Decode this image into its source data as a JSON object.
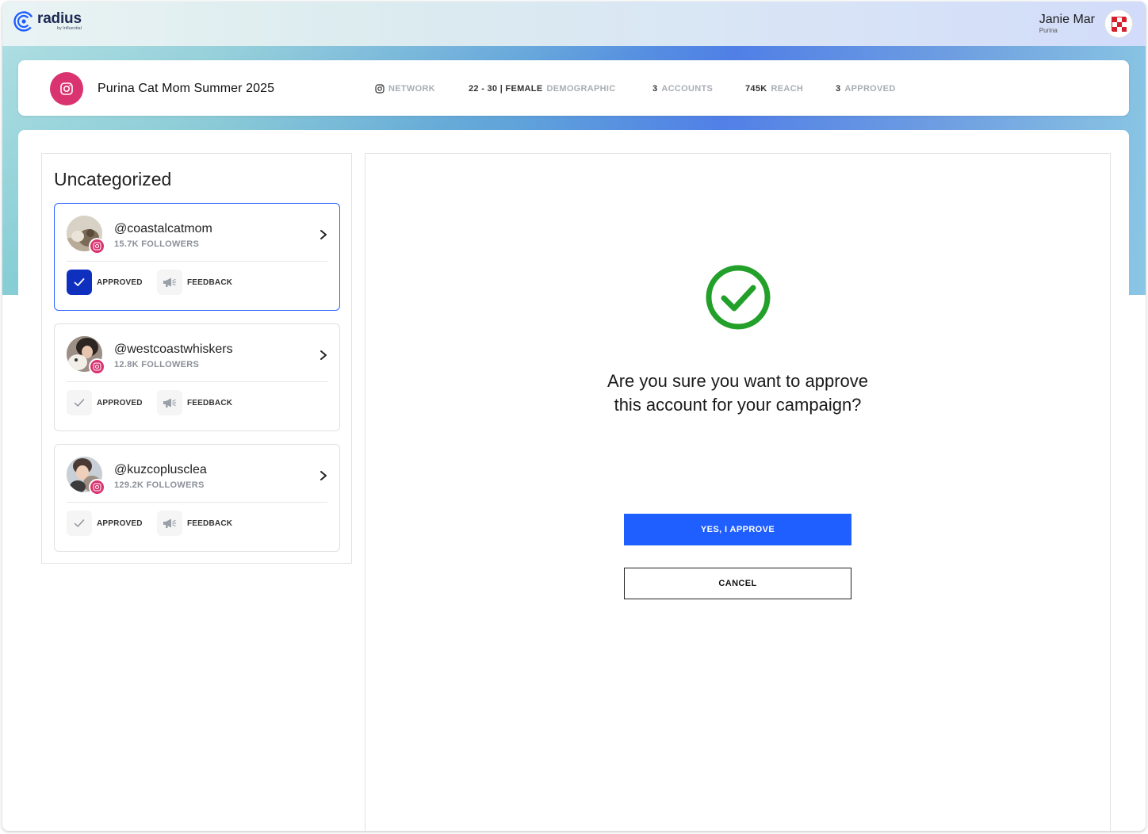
{
  "brand": {
    "name": "radius",
    "sub": "by Influential"
  },
  "user": {
    "name": "Janie Mar",
    "org": "Purina"
  },
  "campaign": {
    "title": "Purina Cat Mom Summer 2025",
    "network_label": "NETWORK",
    "demographic_value": "22 - 30 | FEMALE",
    "demographic_label": "DEMOGRAPHIC",
    "accounts_value": "3",
    "accounts_label": "ACCOUNTS",
    "reach_value": "745K",
    "reach_label": "REACH",
    "approved_value": "3",
    "approved_label": "APPROVED"
  },
  "sidebar": {
    "title": "Uncategorized",
    "accounts": [
      {
        "handle": "@coastalcatmom",
        "followers": "15.7K FOLLOWERS",
        "approved_label": "APPROVED",
        "feedback_label": "FEEDBACK",
        "approved": true,
        "selected": true
      },
      {
        "handle": "@westcoastwhiskers",
        "followers": "12.8K FOLLOWERS",
        "approved_label": "APPROVED",
        "feedback_label": "FEEDBACK",
        "approved": false,
        "selected": false
      },
      {
        "handle": "@kuzcoplusclea",
        "followers": "129.2K FOLLOWERS",
        "approved_label": "APPROVED",
        "feedback_label": "FEEDBACK",
        "approved": false,
        "selected": false
      }
    ]
  },
  "dialog": {
    "line1": "Are you sure you want to approve",
    "line2": "this account for your campaign?",
    "approve_label": "YES, I APPROVE",
    "cancel_label": "CANCEL"
  },
  "colors": {
    "accent": "#1f5eff",
    "approved_fill": "#0f2fbf",
    "instagram": "#d9346f",
    "success": "#22a02a"
  },
  "icons": [
    "radius-logo-icon",
    "purina-checkerboard-icon",
    "instagram-icon",
    "chevron-right-icon",
    "checkmark-icon",
    "megaphone-icon",
    "success-check-circle-icon"
  ]
}
